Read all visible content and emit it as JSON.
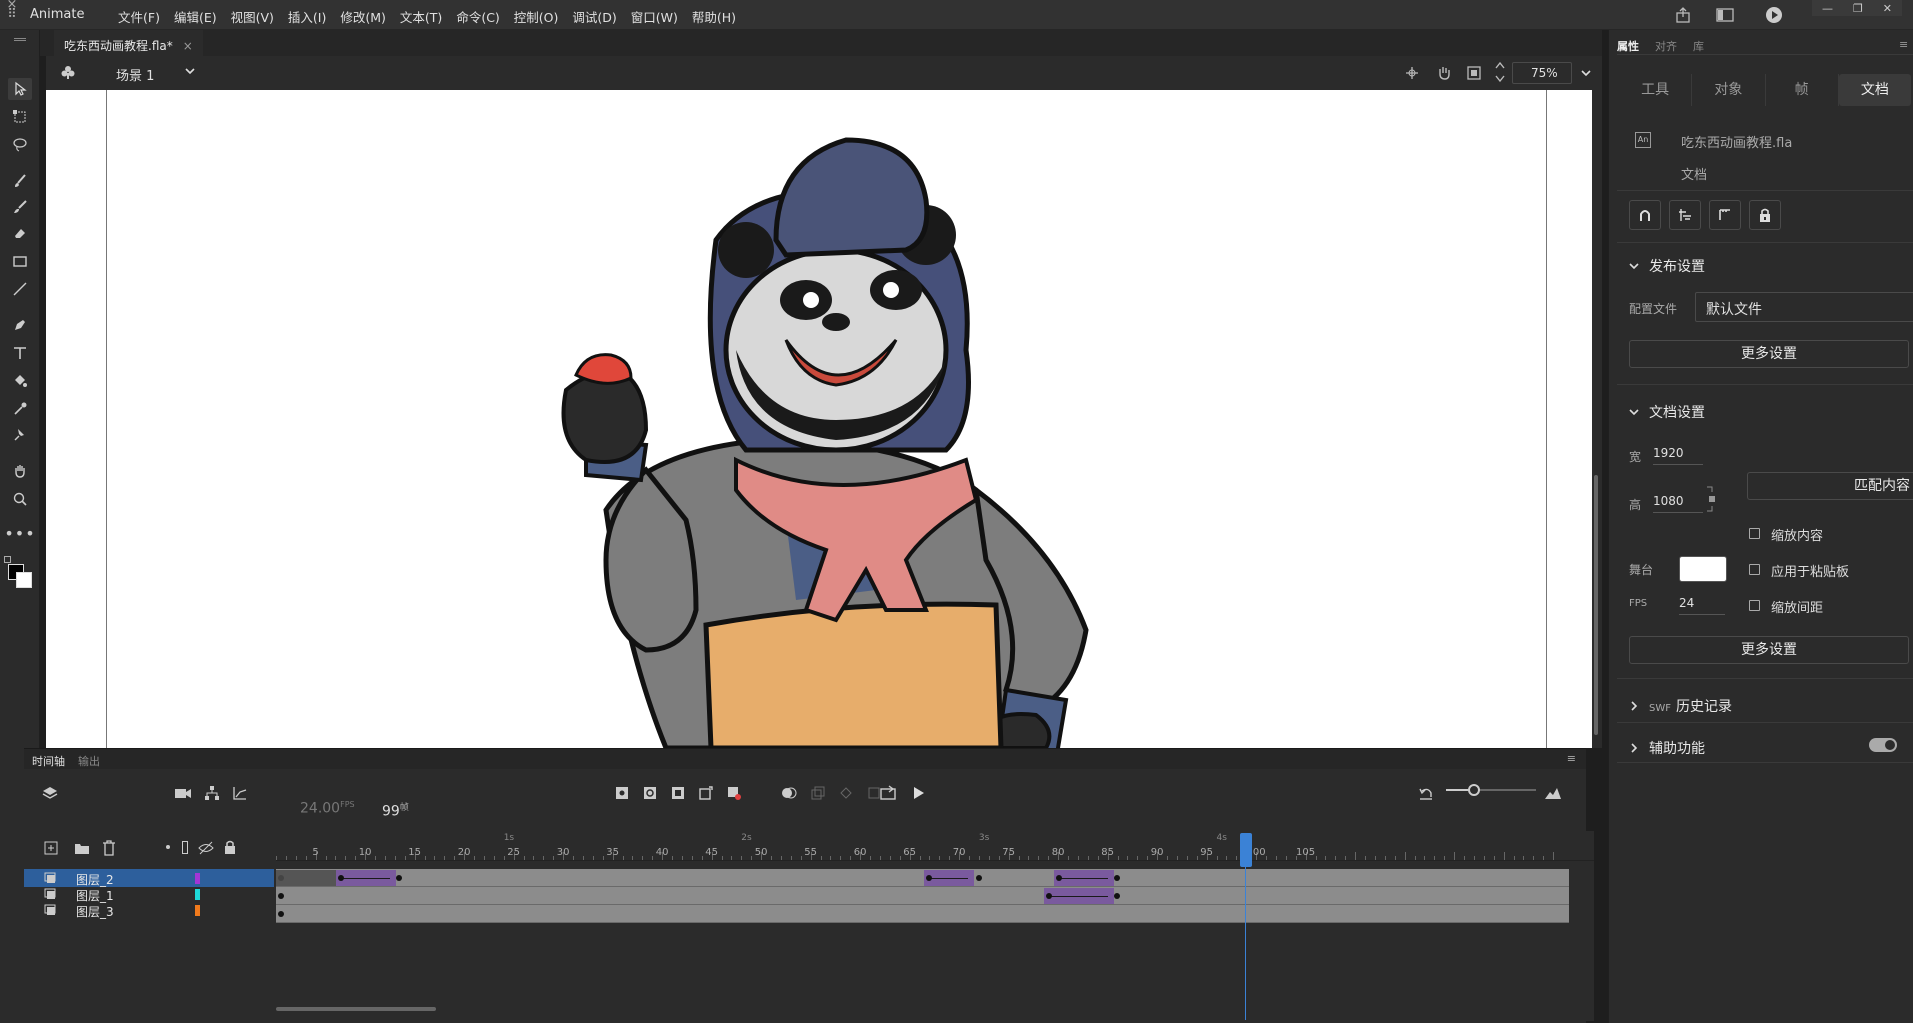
{
  "app": {
    "name": "Animate",
    "menus": [
      "文件(F)",
      "编辑(E)",
      "视图(V)",
      "插入(I)",
      "修改(M)",
      "文本(T)",
      "命令(C)",
      "控制(O)",
      "调试(D)",
      "窗口(W)",
      "帮助(H)"
    ]
  },
  "document": {
    "tab_title": "吃东西动画教程.fla*",
    "tab_close": "×",
    "scene": "场景 1",
    "zoom": "75%"
  },
  "timeline": {
    "tab_timeline": "时间轴",
    "tab_output": "输出",
    "fps": "24.00",
    "fps_unit": "FPS",
    "current_frame": "99",
    "frame_unit": "帧",
    "ruler_numbers": [
      "5",
      "10",
      "15",
      "20",
      "25",
      "30",
      "35",
      "40",
      "45",
      "50",
      "55",
      "60",
      "65",
      "70",
      "75",
      "80",
      "85",
      "90",
      "95",
      "100",
      "105"
    ],
    "seconds": [
      "1s",
      "2s",
      "3s",
      "4s"
    ],
    "playhead_frame": 99,
    "layers": [
      {
        "name": "图层_2",
        "color": "#a235d6",
        "selected": true
      },
      {
        "name": "图层_1",
        "color": "#1ed8d8",
        "selected": false
      },
      {
        "name": "图层_3",
        "color": "#f07a1c",
        "selected": false
      }
    ]
  },
  "properties": {
    "tabs": [
      "属性",
      "对齐",
      "库"
    ],
    "subtabs": [
      "工具",
      "对象",
      "帧",
      "文档"
    ],
    "file_name": "吃东西动画教程.fla",
    "file_icon": "An",
    "file_type": "文档",
    "publish": {
      "title": "发布设置",
      "profile_label": "配置文件",
      "profile_value": "默认文件",
      "more": "更多设置"
    },
    "doc_settings": {
      "title": "文档设置",
      "width_label": "宽",
      "width": "1920",
      "height_label": "高",
      "height": "1080",
      "match_button": "匹配内容",
      "scale_content": "缩放内容",
      "apply_paste": "应用于粘贴板",
      "stage_label": "舞台",
      "stage_color": "#ffffff",
      "fps_label": "FPS",
      "fps": "24",
      "scale_spacing": "缩放间距",
      "more": "更多设置"
    },
    "swf_history_tag": "SWF",
    "swf_history": "历史记录",
    "accessibility": "辅助功能"
  }
}
